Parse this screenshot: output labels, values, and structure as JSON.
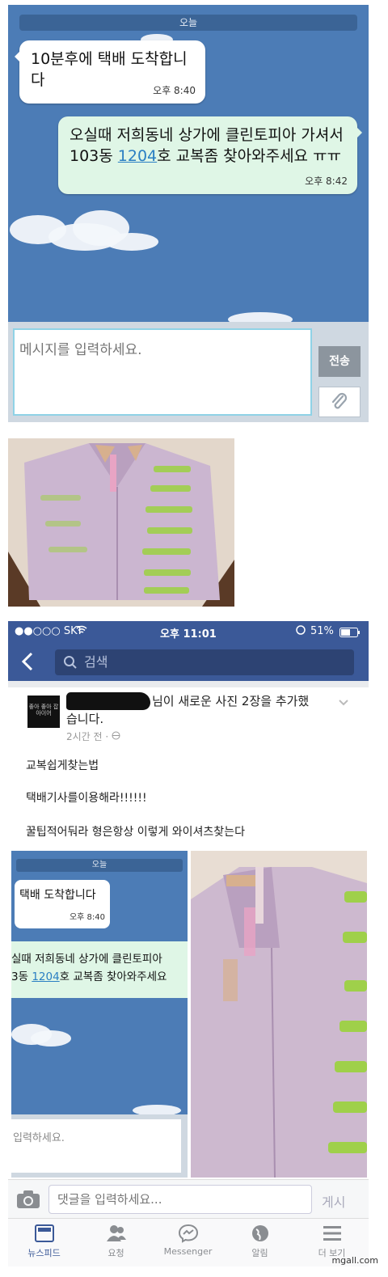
{
  "chat": {
    "date_label": "오늘",
    "incoming": {
      "text": "10분후에 택배 도착합니다",
      "time": "오후 8:40"
    },
    "outgoing": {
      "line1": "오실때 저희동네 상가에 클린토피아 가셔서",
      "line2_pre": "103동 ",
      "line2_link": "1204",
      "line2_post": "호 교복좀 찾아와주세요 ㅠㅠ",
      "time": "오후 8:42"
    },
    "input_placeholder": "메시지를 입력하세요.",
    "send_label": "전송"
  },
  "facebook": {
    "status": {
      "carrier": "●●○○○ SKT",
      "time": "오후 11:01",
      "battery": "51%"
    },
    "search_placeholder": "검색",
    "post": {
      "avatar_text": "좋아 좋아 잡아이어",
      "headline_a": "님이 새로운 사진 2장을 추가했",
      "headline_b": "습니다.",
      "time": "2시간 전 · ",
      "line1": "교복쉽게찾는법",
      "line2": "택배기사를이용해라!!!!!!",
      "line3": "꿀팁적어둬라 형은항상 이렇게 와이셔츠찾는다"
    },
    "thumb_chat": {
      "date_label": "오늘",
      "incoming": "택배 도착합니다",
      "time": "오후 8:40",
      "out_line1": "실때 저희동네 상가에 클린토피아",
      "out_line2_pre": "3동 ",
      "out_line2_link": "1204",
      "out_line2_post": "호 교복좀 찾아와주세요",
      "input": "입력하세요."
    },
    "comment_placeholder": "댓글을 입력하세요...",
    "post_button": "게시",
    "tabs": [
      "뉴스피드",
      "요청",
      "Messenger",
      "알림",
      "더 보기"
    ]
  },
  "watermark": "mgall.com",
  "colors": {
    "chat_bg": "#4c7cb6",
    "fb_blue": "#3b5998",
    "bubble_out": "#dff6e6"
  }
}
